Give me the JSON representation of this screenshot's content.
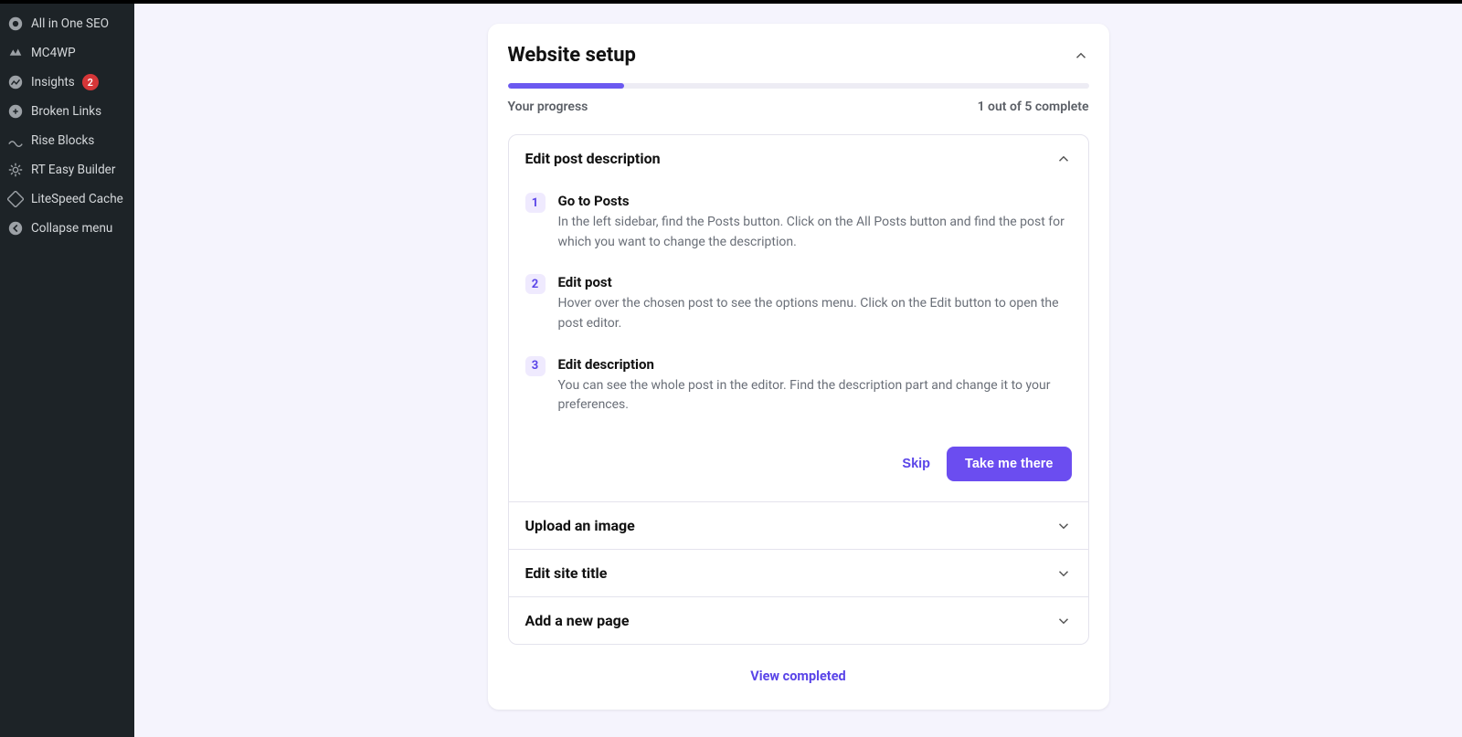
{
  "sidebar": {
    "items": [
      {
        "label": "All in One SEO",
        "icon": "seo"
      },
      {
        "label": "MC4WP",
        "icon": "mc4wp"
      },
      {
        "label": "Insights",
        "icon": "insights",
        "badge": "2"
      },
      {
        "label": "Broken Links",
        "icon": "brokenlinks"
      },
      {
        "label": "Rise Blocks",
        "icon": "riseblocks"
      },
      {
        "label": "RT Easy Builder",
        "icon": "gear"
      },
      {
        "label": "LiteSpeed Cache",
        "icon": "litespeed"
      },
      {
        "label": "Collapse menu",
        "icon": "collapse"
      }
    ]
  },
  "card": {
    "title": "Website setup",
    "progress": {
      "label": "Your progress",
      "status": "1 out of 5 complete",
      "percent": 20
    },
    "tasks": [
      {
        "title": "Edit post description",
        "expanded": true,
        "steps": [
          {
            "num": "1",
            "title": "Go to Posts",
            "desc": "In the left sidebar, find the Posts button. Click on the All Posts button and find the post for which you want to change the description."
          },
          {
            "num": "2",
            "title": "Edit post",
            "desc": "Hover over the chosen post to see the options menu. Click on the Edit button to open the post editor."
          },
          {
            "num": "3",
            "title": "Edit description",
            "desc": "You can see the whole post in the editor. Find the description part and change it to your preferences."
          }
        ],
        "actions": {
          "skip": "Skip",
          "go": "Take me there"
        }
      },
      {
        "title": "Upload an image",
        "expanded": false
      },
      {
        "title": "Edit site title",
        "expanded": false
      },
      {
        "title": "Add a new page",
        "expanded": false
      }
    ],
    "view_completed": "View completed"
  }
}
